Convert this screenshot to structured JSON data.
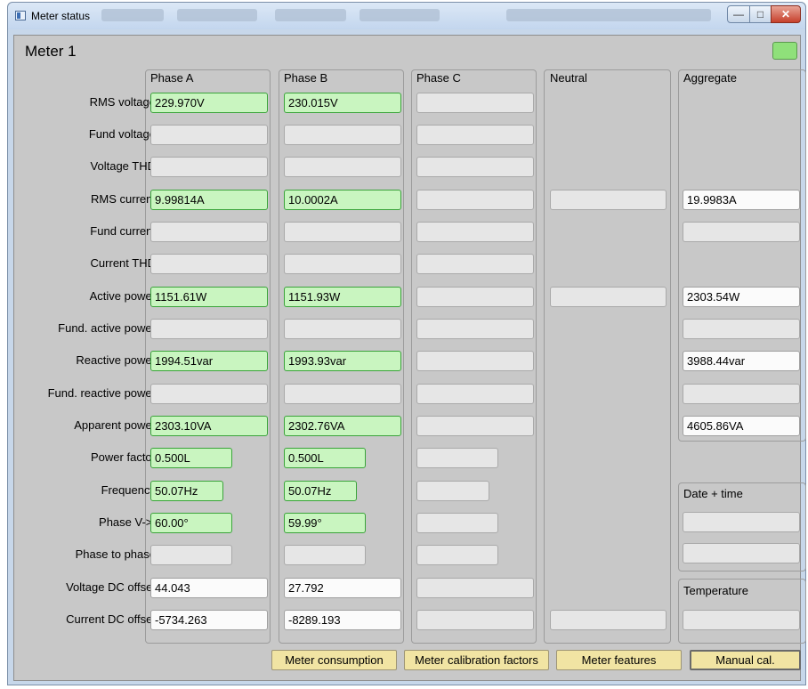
{
  "window": {
    "title": "Meter status"
  },
  "meter": {
    "title": "Meter 1"
  },
  "columns": {
    "phase_a": "Phase A",
    "phase_b": "Phase B",
    "phase_c": "Phase C",
    "neutral": "Neutral",
    "aggregate": "Aggregate"
  },
  "rows": [
    {
      "label": "RMS voltage",
      "a": "229.970V",
      "b": "230.015V",
      "agg": ""
    },
    {
      "label": "Fund voltage",
      "a": "",
      "b": ""
    },
    {
      "label": "Voltage THD",
      "a": "",
      "b": ""
    },
    {
      "label": "RMS current",
      "a": "9.99814A",
      "b": "10.0002A",
      "n": "",
      "agg": "19.9983A"
    },
    {
      "label": "Fund current",
      "a": "",
      "b": "",
      "agg": ""
    },
    {
      "label": "Current THD",
      "a": "",
      "b": ""
    },
    {
      "label": "Active power",
      "a": "1151.61W",
      "b": "1151.93W",
      "n": "",
      "agg": "2303.54W"
    },
    {
      "label": "Fund. active power",
      "a": "",
      "b": "",
      "agg": ""
    },
    {
      "label": "Reactive power",
      "a": "1994.51var",
      "b": "1993.93var",
      "agg": "3988.44var"
    },
    {
      "label": "Fund. reactive power",
      "a": "",
      "b": "",
      "agg": ""
    },
    {
      "label": "Apparent power",
      "a": "2303.10VA",
      "b": "2302.76VA",
      "agg": "4605.86VA"
    },
    {
      "label": "Power factor",
      "a": "0.500L",
      "b": "0.500L"
    },
    {
      "label": "Frequency",
      "a": "50.07Hz",
      "b": "50.07Hz"
    },
    {
      "label": "Phase V->I",
      "a": "60.00°",
      "b": "59.99°"
    },
    {
      "label": "Phase to phase",
      "a": "",
      "b": ""
    },
    {
      "label": "Voltage DC offset",
      "a": "44.043",
      "b": "27.792"
    },
    {
      "label": "Current DC offset",
      "a": "-5734.263",
      "b": "-8289.193",
      "n": ""
    }
  ],
  "date_time": {
    "heading": "Date + time",
    "date": "",
    "time": ""
  },
  "temperature": {
    "heading": "Temperature",
    "value": ""
  },
  "buttons": {
    "consumption": "Meter consumption",
    "calibration": "Meter calibration factors",
    "features": "Meter features",
    "manual": "Manual cal."
  },
  "colors": {
    "ok_green": "#c9f5c0",
    "button_yellow": "#f1e4a3"
  }
}
